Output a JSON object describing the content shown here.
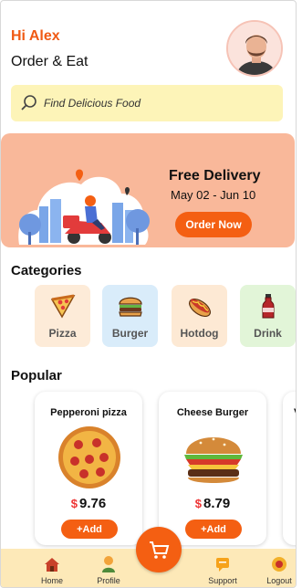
{
  "header": {
    "greeting": "Hi Alex",
    "subtitle": "Order & Eat",
    "avatar_icon": "user-avatar-icon"
  },
  "search": {
    "placeholder": "Find Delicious Food",
    "icon": "search-icon"
  },
  "banner": {
    "title": "Free Delivery",
    "dates": "May 02 - Jun 10",
    "button_label": "Order Now",
    "bg_color": "#f9b89a",
    "button_color": "#f45f12"
  },
  "categories": {
    "title": "Categories",
    "items": [
      {
        "label": "Pizza",
        "icon": "pizza-icon",
        "bg": "#fdebd8"
      },
      {
        "label": "Burger",
        "icon": "burger-icon",
        "bg": "#d9ecfa"
      },
      {
        "label": "Hotdog",
        "icon": "hotdog-icon",
        "bg": "#fde9d4"
      },
      {
        "label": "Drink",
        "icon": "drink-icon",
        "bg": "#e2f5d8"
      }
    ]
  },
  "popular": {
    "title": "Popular",
    "items": [
      {
        "name": "Pepperoni pizza",
        "currency": "$",
        "price": "9.76",
        "add_label": "+Add",
        "icon": "pepperoni-pizza-icon"
      },
      {
        "name": "Cheese Burger",
        "currency": "$",
        "price": "8.79",
        "add_label": "+Add",
        "icon": "cheese-burger-icon"
      },
      {
        "name": "Ve",
        "icon": "veg-item-icon"
      }
    ]
  },
  "nav": {
    "items": [
      {
        "label": "Home",
        "icon": "home-icon"
      },
      {
        "label": "Profile",
        "icon": "profile-icon"
      },
      {
        "label": "Support",
        "icon": "support-icon"
      },
      {
        "label": "Logout",
        "icon": "logout-icon"
      }
    ],
    "cart_icon": "cart-icon",
    "accent": "#f45f12"
  }
}
